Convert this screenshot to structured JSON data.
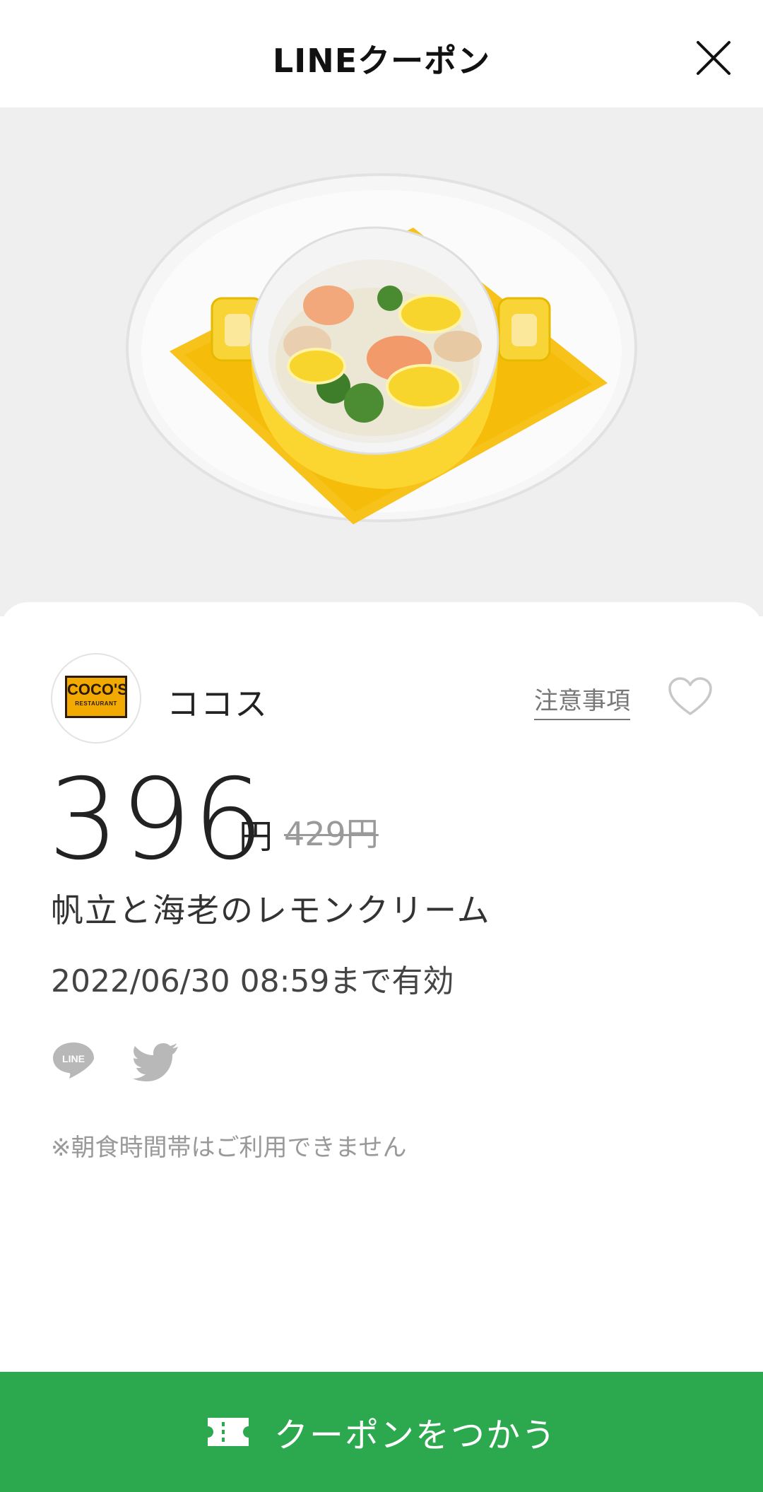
{
  "header": {
    "title": "LINEクーポン",
    "close_icon": "close-icon"
  },
  "hero": {
    "image_icon": "food-photo"
  },
  "store": {
    "name": "ココス",
    "logo_text": "COCO'S",
    "logo_subtext": "RESTAURANT",
    "notes_link": "注意事項",
    "favorite_icon": "heart-icon"
  },
  "price": {
    "current": "396",
    "unit": "円",
    "original": "429円"
  },
  "product": {
    "name": "帆立と海老のレモンクリーム"
  },
  "validity": {
    "text": "2022/06/30 08:59まで有効"
  },
  "share": {
    "line_icon": "line-share-icon",
    "twitter_icon": "twitter-share-icon"
  },
  "note": {
    "text": "※朝食時間帯はご利用できません"
  },
  "cta": {
    "label": "クーポンをつかう",
    "icon": "ticket-icon"
  },
  "colors": {
    "accent": "#2ca84f",
    "hero_background": "#efefef",
    "logo_orange": "#f2a900"
  }
}
